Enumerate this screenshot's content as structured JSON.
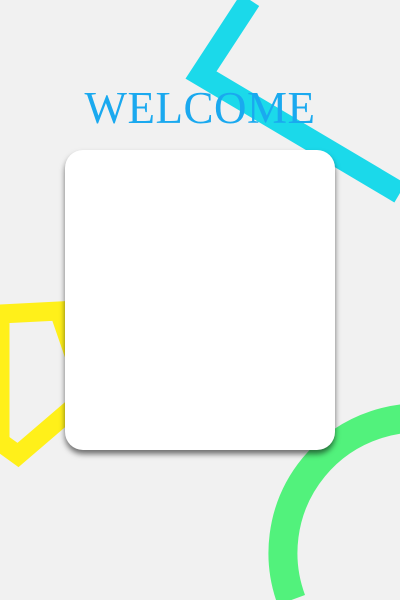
{
  "title": "WELCOME",
  "colors": {
    "background": "#f1f1f1",
    "title": "#1aa9ef",
    "cyan_shape": "#1bd9ea",
    "yellow_shape": "#fff01a",
    "green_shape": "#52f27c",
    "card": "#ffffff"
  }
}
